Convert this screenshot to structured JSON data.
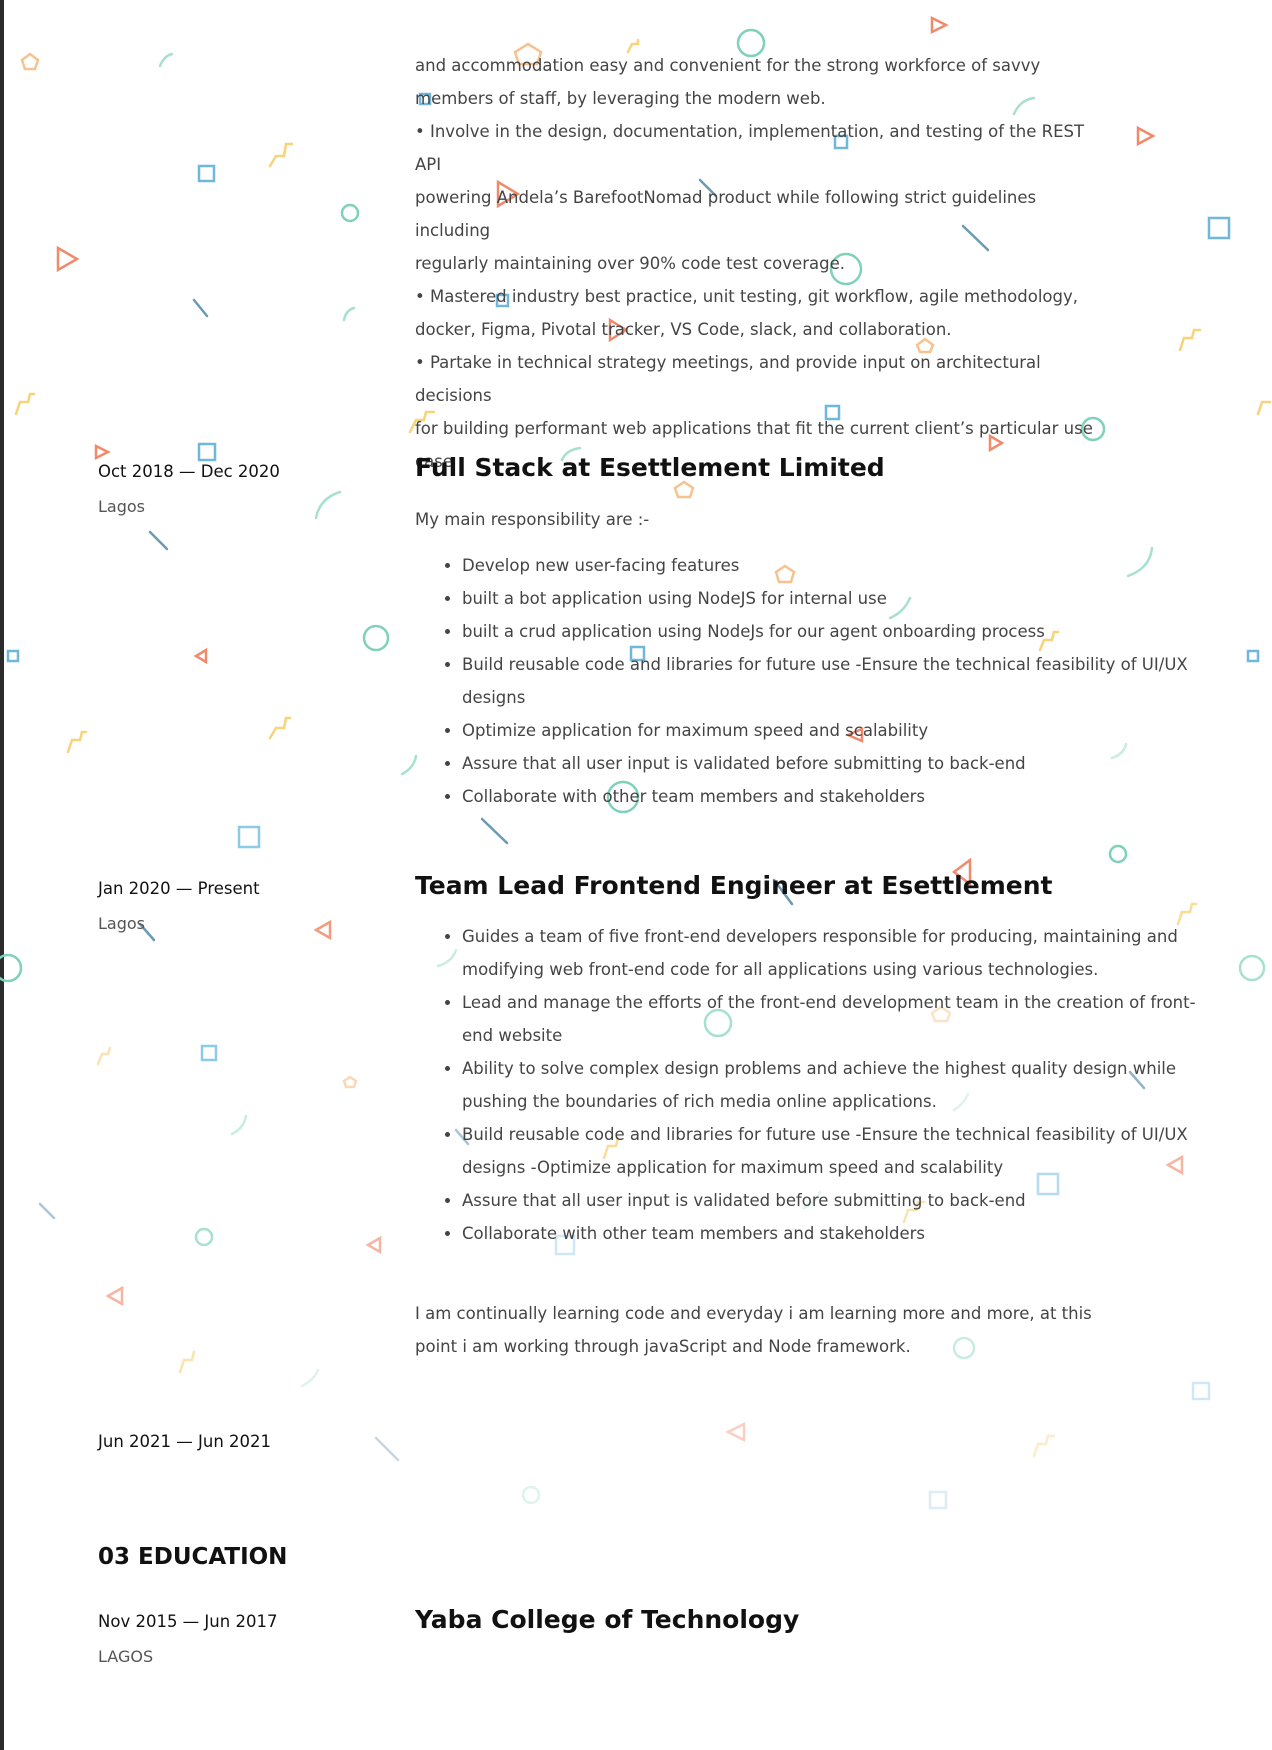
{
  "intro_lines": [
    "and accommodation easy and convenient for the strong workforce of savvy",
    "members of staff, by leveraging the modern web.",
    "• Involve in the design, documentation, implementation, and testing of the REST API",
    "powering Andela’s BarefootNomad product while following strict guidelines including",
    "regularly maintaining over 90% code test coverage.",
    "• Mastered industry best practice, unit testing, git workflow, agile methodology,",
    "docker, Figma, Pivotal tracker, VS Code, slack, and collaboration.",
    "• Partake in technical strategy meetings, and provide input on architectural decisions",
    "for building performant web applications that fit the current client’s particular use",
    "case"
  ],
  "job_esettlement": {
    "date": "Oct 2018 — Dec 2020",
    "location": "Lagos",
    "title": "Full Stack at Esettlement Limited",
    "intro": "My main responsibility are :-",
    "bullets": [
      "Develop new user-facing features",
      "built a bot application using NodeJS for internal use",
      "built a crud application using NodeJs for our agent onboarding process",
      " Build reusable code and libraries for future use -Ensure the technical feasibility of UI/UX designs",
      "Optimize application for maximum speed and scalability",
      "Assure that all user input is validated before submitting to back-end",
      "Collaborate with other team members and stakeholders"
    ]
  },
  "job_team_lead": {
    "date": "Jan 2020 — Present",
    "location": "Lagos",
    "title": "Team Lead Frontend Engineer  at Esettlement",
    "bullets": [
      "Guides a team of five front-end developers responsible for producing, maintaining and modifying web front-end code for all  applications using various technologies.",
      "Lead and manage the efforts of the front-end development team in the creation of front-end website",
      "Ability to solve complex design problems and achieve the highest quality design while pushing the boundaries of rich media online applications.",
      "Build reusable code and libraries for future use -Ensure the technical feasibility of UI/UX designs -Optimize application for maximum speed and scalability",
      "Assure that all user input is validated before submitting to back-end",
      "Collaborate with other team members and stakeholders"
    ],
    "closing": "I am continually learning code and everyday i am learning more and more, at this point i am working through javaScript and Node framework."
  },
  "job_blank": {
    "date": "Jun 2021 — Jun 2021"
  },
  "education": {
    "section_title": "03  EDUCATION",
    "date": "Nov 2015 — Jun 2017",
    "location": "LAGOS",
    "school": "Yaba College of Technology"
  },
  "colors": {
    "orange": "#f08a6a",
    "peach": "#f7c28f",
    "yellow": "#f7d37a",
    "blue": "#6fb8dc",
    "teal": "#7fd1b9",
    "slate": "#6a9ab5"
  }
}
